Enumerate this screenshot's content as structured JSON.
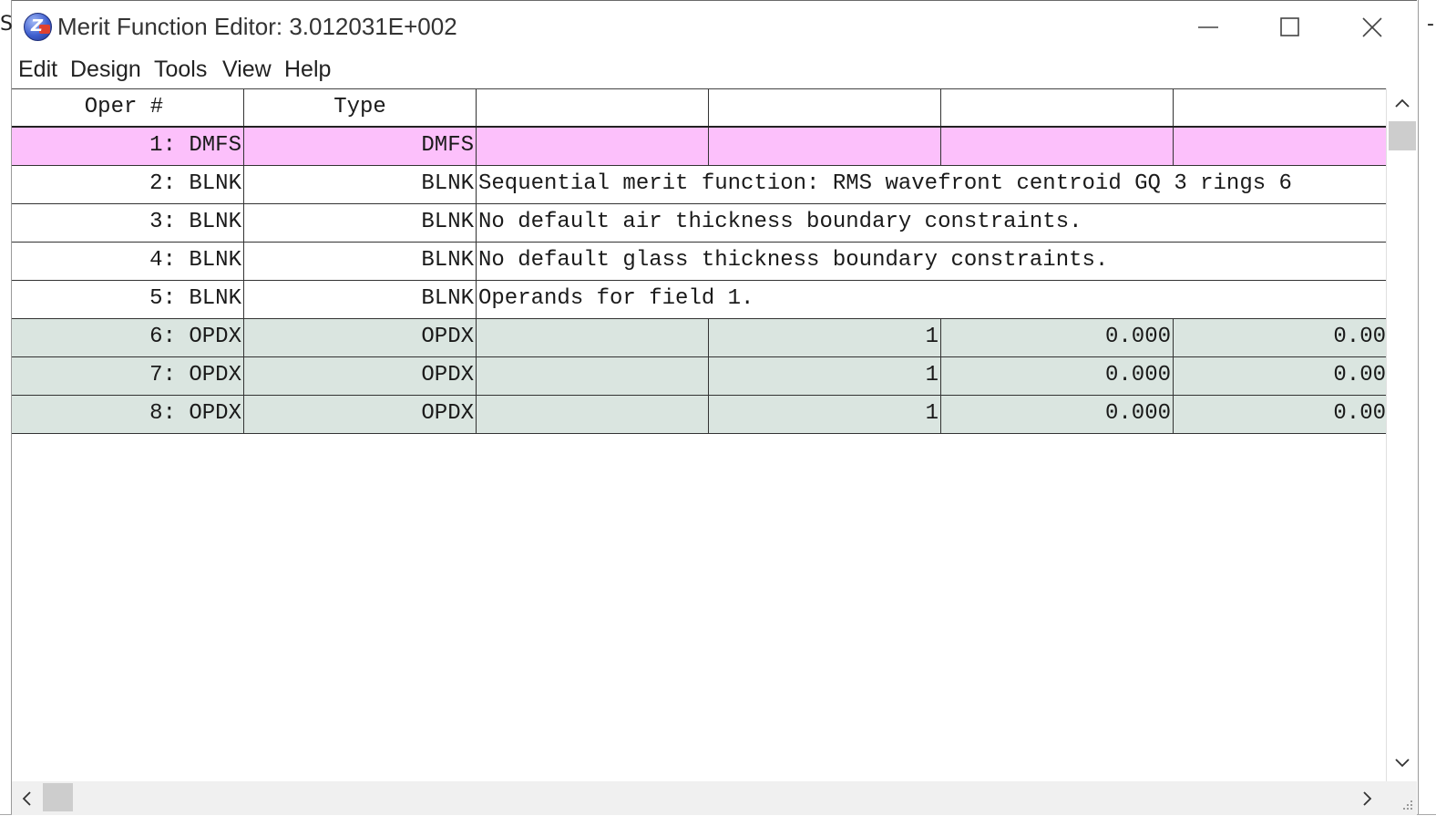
{
  "window": {
    "title": "Merit Function Editor: 3.012031E+002"
  },
  "background": {
    "left_fragment": "S",
    "right_fragment": "-"
  },
  "menu": {
    "items": [
      "Edit",
      "Design",
      "Tools",
      "View",
      "Help"
    ]
  },
  "table": {
    "headers": [
      "Oper #",
      "Type",
      "",
      "",
      "",
      ""
    ],
    "rows": [
      {
        "style": "pink",
        "oper": "1: DMFS",
        "type": "DMFS",
        "comment": "",
        "cells": [
          "",
          "",
          "",
          ""
        ]
      },
      {
        "style": "plain",
        "oper": "2: BLNK",
        "type": "BLNK",
        "comment": "Sequential merit function: RMS wavefront centroid GQ 3 rings 6",
        "cells": []
      },
      {
        "style": "plain",
        "oper": "3: BLNK",
        "type": "BLNK",
        "comment": "No default air thickness boundary constraints.",
        "cells": []
      },
      {
        "style": "plain",
        "oper": "4: BLNK",
        "type": "BLNK",
        "comment": "No default glass thickness boundary constraints.",
        "cells": []
      },
      {
        "style": "plain",
        "oper": "5: BLNK",
        "type": "BLNK",
        "comment": "Operands for field 1.",
        "cells": []
      },
      {
        "style": "green",
        "oper": "6: OPDX",
        "type": "OPDX",
        "comment": "",
        "cells": [
          "",
          "1",
          "0.000",
          "0.00"
        ]
      },
      {
        "style": "green",
        "oper": "7: OPDX",
        "type": "OPDX",
        "comment": "",
        "cells": [
          "",
          "1",
          "0.000",
          "0.00"
        ]
      },
      {
        "style": "green",
        "oper": "8: OPDX",
        "type": "OPDX",
        "comment": "",
        "cells": [
          "",
          "1",
          "0.000",
          "0.00"
        ]
      }
    ]
  },
  "colors": {
    "dmfs_row": "#fcc0fb",
    "operand_row": "#dae5e0",
    "scrollbar_thumb": "#cdcdcd"
  },
  "icons": {
    "app": "zemax-app-icon",
    "minimize": "minimize-icon",
    "maximize": "maximize-icon",
    "close": "close-icon"
  }
}
